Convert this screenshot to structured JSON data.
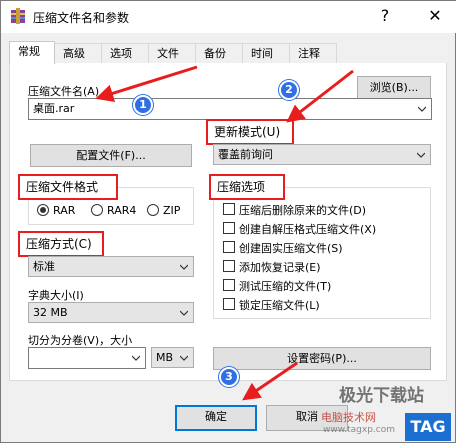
{
  "window": {
    "title": "压缩文件名和参数",
    "help_glyph": "?",
    "close_glyph": "✕"
  },
  "tabs": [
    {
      "label": "常规",
      "active": true
    },
    {
      "label": "高级"
    },
    {
      "label": "选项"
    },
    {
      "label": "文件"
    },
    {
      "label": "备份"
    },
    {
      "label": "时间"
    },
    {
      "label": "注释"
    }
  ],
  "general": {
    "archive_name_label": "压缩文件名(A)",
    "browse_label": "浏览(B)...",
    "archive_name_value": "桌面.rar",
    "update_mode_label": "更新模式(U)",
    "update_mode_value": "覆盖前询问",
    "profiles_label": "配置文件(F)...",
    "format_label": "压缩文件格式",
    "formats": [
      "RAR",
      "RAR4",
      "ZIP"
    ],
    "format_selected": "RAR",
    "method_label": "压缩方式(C)",
    "method_value": "标准",
    "dict_label": "字典大小(I)",
    "dict_value": "32 MB",
    "split_label": "切分为分卷(V)，大小",
    "split_value": "",
    "split_unit": "MB",
    "set_password_label": "设置密码(P)...",
    "options_label": "压缩选项",
    "options": [
      {
        "label": "压缩后删除原来的文件(D)",
        "checked": false
      },
      {
        "label": "创建自解压格式压缩文件(X)",
        "checked": false
      },
      {
        "label": "创建固实压缩文件(S)",
        "checked": false
      },
      {
        "label": "添加恢复记录(E)",
        "checked": false
      },
      {
        "label": "测试压缩的文件(T)",
        "checked": false
      },
      {
        "label": "锁定压缩文件(L)",
        "checked": false
      }
    ]
  },
  "footer": {
    "ok_label": "确定",
    "cancel_label": "取消"
  },
  "annotations": {
    "steps": [
      "1",
      "2",
      "3"
    ],
    "accent_color": "#e81d1d",
    "badge_color": "#2f6fe3"
  },
  "watermark": {
    "line1": "极光下载站",
    "line2": "电脑技术网",
    "line3": "www.tagxp.com",
    "logo": "TAG"
  }
}
